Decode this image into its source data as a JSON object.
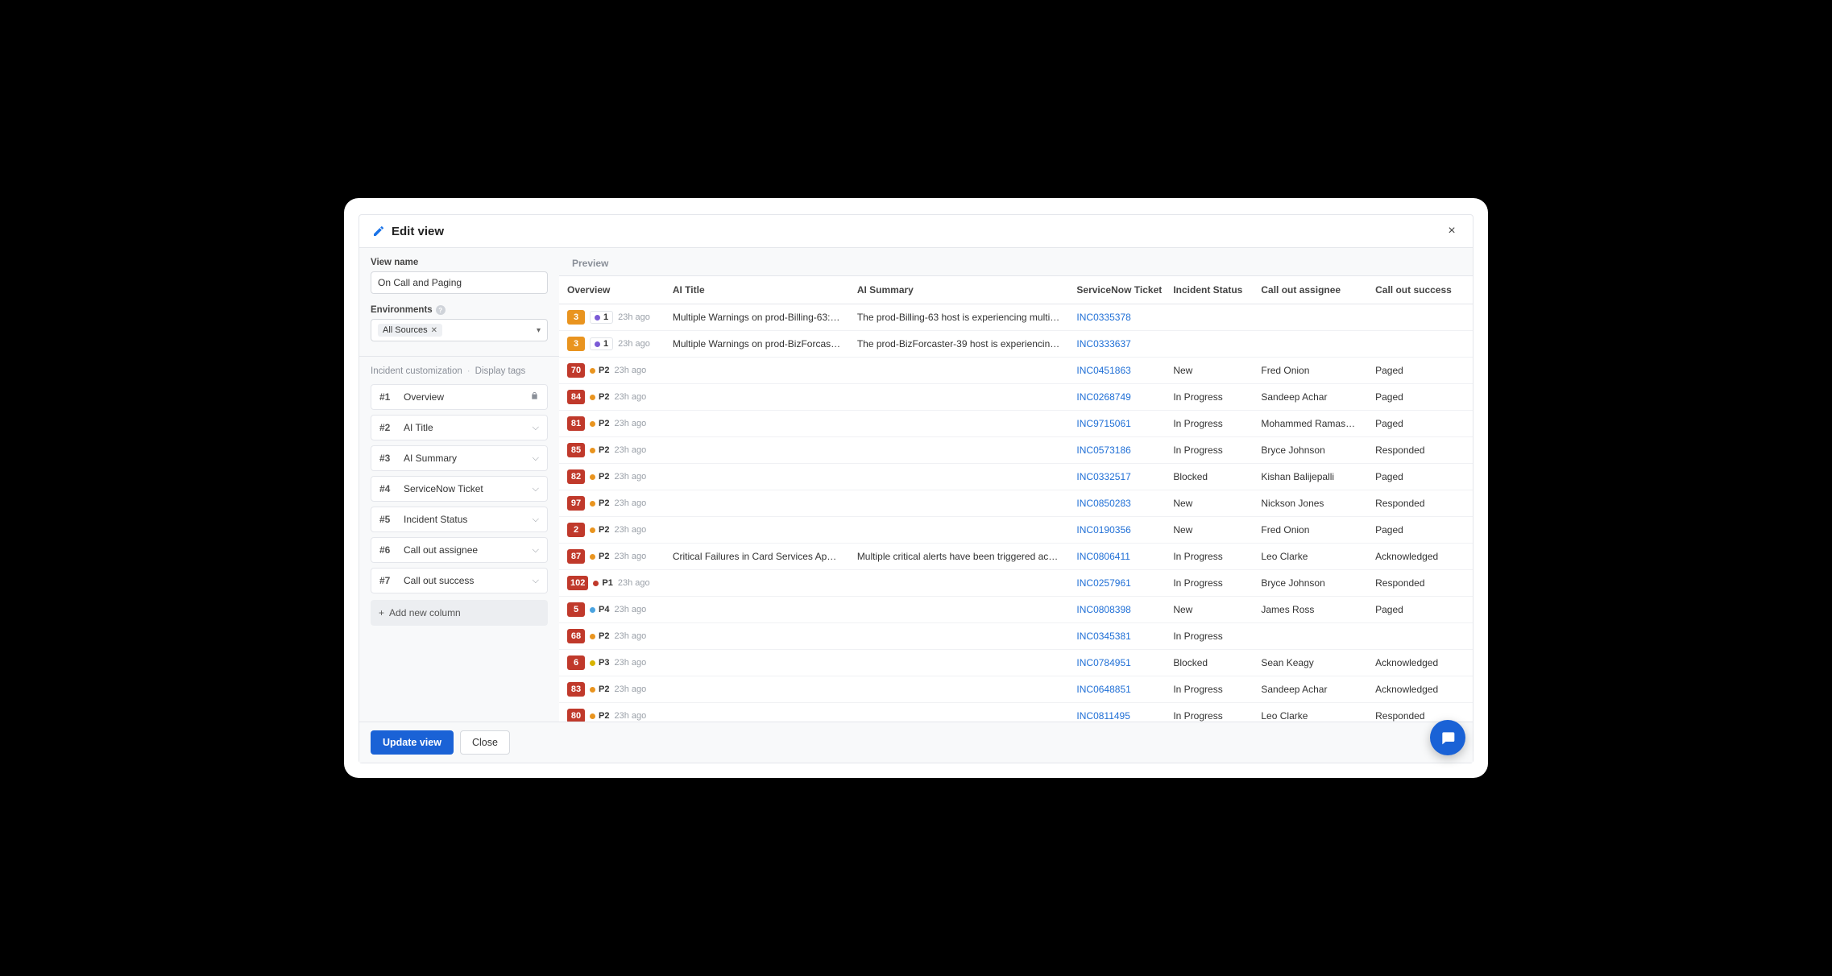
{
  "modal": {
    "title": "Edit view",
    "close_label": "×"
  },
  "sidebar": {
    "view_name_label": "View name",
    "view_name_value": "On Call and Paging",
    "env_label": "Environments",
    "env_chip": "All Sources",
    "customization_label": "Incident customization",
    "display_tags_label": "Display tags",
    "columns": [
      {
        "idx": "#1",
        "name": "Overview",
        "locked": true
      },
      {
        "idx": "#2",
        "name": "AI Title",
        "locked": false
      },
      {
        "idx": "#3",
        "name": "AI Summary",
        "locked": false
      },
      {
        "idx": "#4",
        "name": "ServiceNow Ticket",
        "locked": false
      },
      {
        "idx": "#5",
        "name": "Incident Status",
        "locked": false
      },
      {
        "idx": "#6",
        "name": "Call out assignee",
        "locked": false
      },
      {
        "idx": "#7",
        "name": "Call out success",
        "locked": false
      }
    ],
    "add_column_label": "Add new column"
  },
  "preview": {
    "label": "Preview",
    "headers": [
      "Overview",
      "AI Title",
      "AI Summary",
      "ServiceNow Ticket",
      "Incident Status",
      "Call out assignee",
      "Call out success"
    ],
    "rows": [
      {
        "count": "3",
        "count_color": "orange",
        "priority": "1",
        "priority_class": "purple",
        "outlined": true,
        "age": "23h ago",
        "ai_title": "Multiple Warnings on prod-Billing-63: D...",
        "ai_summary": "The prod-Billing-63 host is experiencing multiple ...",
        "ticket": "INC0335378",
        "status": "",
        "assignee": "",
        "success": ""
      },
      {
        "count": "3",
        "count_color": "orange",
        "priority": "1",
        "priority_class": "purple",
        "outlined": true,
        "age": "23h ago",
        "ai_title": "Multiple Warnings on prod-BizForcaste...",
        "ai_summary": "The prod-BizForcaster-39 host is experiencing m...",
        "ticket": "INC0333637",
        "status": "",
        "assignee": "",
        "success": ""
      },
      {
        "count": "70",
        "count_color": "red",
        "priority": "P2",
        "priority_class": "p2",
        "outlined": false,
        "age": "23h ago",
        "ai_title": "",
        "ai_summary": "",
        "ticket": "INC0451863",
        "status": "New",
        "assignee": "Fred Onion",
        "success": "Paged"
      },
      {
        "count": "84",
        "count_color": "red",
        "priority": "P2",
        "priority_class": "p2",
        "outlined": false,
        "age": "23h ago",
        "ai_title": "",
        "ai_summary": "",
        "ticket": "INC0268749",
        "status": "In Progress",
        "assignee": "Sandeep Achar",
        "success": "Paged"
      },
      {
        "count": "81",
        "count_color": "red",
        "priority": "P2",
        "priority_class": "p2",
        "outlined": false,
        "age": "23h ago",
        "ai_title": "",
        "ai_summary": "",
        "ticket": "INC9715061",
        "status": "In Progress",
        "assignee": "Mohammed Ramaswa...",
        "success": "Paged"
      },
      {
        "count": "85",
        "count_color": "red",
        "priority": "P2",
        "priority_class": "p2",
        "outlined": false,
        "age": "23h ago",
        "ai_title": "",
        "ai_summary": "",
        "ticket": "INC0573186",
        "status": "In Progress",
        "assignee": "Bryce Johnson",
        "success": "Responded"
      },
      {
        "count": "82",
        "count_color": "red",
        "priority": "P2",
        "priority_class": "p2",
        "outlined": false,
        "age": "23h ago",
        "ai_title": "",
        "ai_summary": "",
        "ticket": "INC0332517",
        "status": "Blocked",
        "assignee": "Kishan Balijepalli",
        "success": "Paged"
      },
      {
        "count": "97",
        "count_color": "red",
        "priority": "P2",
        "priority_class": "p2",
        "outlined": false,
        "age": "23h ago",
        "ai_title": "",
        "ai_summary": "",
        "ticket": "INC0850283",
        "status": "New",
        "assignee": "Nickson Jones",
        "success": "Responded"
      },
      {
        "count": "2",
        "count_color": "red",
        "priority": "P2",
        "priority_class": "p2",
        "outlined": false,
        "age": "23h ago",
        "ai_title": "",
        "ai_summary": "",
        "ticket": "INC0190356",
        "status": "New",
        "assignee": "Fred Onion",
        "success": "Paged"
      },
      {
        "count": "87",
        "count_color": "red",
        "priority": "P2",
        "priority_class": "p2",
        "outlined": false,
        "age": "23h ago",
        "ai_title": "Critical Failures in Card Services Applic...",
        "ai_summary": "Multiple critical alerts have been triggered across ...",
        "ticket": "INC0806411",
        "status": "In Progress",
        "assignee": "Leo Clarke",
        "success": "Acknowledged"
      },
      {
        "count": "102",
        "count_color": "red",
        "priority": "P1",
        "priority_class": "p1",
        "outlined": false,
        "age": "23h ago",
        "ai_title": "",
        "ai_summary": "",
        "ticket": "INC0257961",
        "status": "In Progress",
        "assignee": "Bryce Johnson",
        "success": "Responded"
      },
      {
        "count": "5",
        "count_color": "red",
        "priority": "P4",
        "priority_class": "p4",
        "outlined": false,
        "age": "23h ago",
        "ai_title": "",
        "ai_summary": "",
        "ticket": "INC0808398",
        "status": "New",
        "assignee": "James Ross",
        "success": "Paged"
      },
      {
        "count": "68",
        "count_color": "red",
        "priority": "P2",
        "priority_class": "p2",
        "outlined": false,
        "age": "23h ago",
        "ai_title": "",
        "ai_summary": "",
        "ticket": "INC0345381",
        "status": "In Progress",
        "assignee": "",
        "success": ""
      },
      {
        "count": "6",
        "count_color": "red",
        "priority": "P3",
        "priority_class": "p3",
        "outlined": false,
        "age": "23h ago",
        "ai_title": "",
        "ai_summary": "",
        "ticket": "INC0784951",
        "status": "Blocked",
        "assignee": "Sean Keagy",
        "success": "Acknowledged"
      },
      {
        "count": "83",
        "count_color": "red",
        "priority": "P2",
        "priority_class": "p2",
        "outlined": false,
        "age": "23h ago",
        "ai_title": "",
        "ai_summary": "",
        "ticket": "INC0648851",
        "status": "In Progress",
        "assignee": "Sandeep Achar",
        "success": "Acknowledged"
      },
      {
        "count": "80",
        "count_color": "red",
        "priority": "P2",
        "priority_class": "p2",
        "outlined": false,
        "age": "23h ago",
        "ai_title": "",
        "ai_summary": "",
        "ticket": "INC0811495",
        "status": "In Progress",
        "assignee": "Leo Clarke",
        "success": "Responded"
      }
    ]
  },
  "footer": {
    "update_label": "Update view",
    "close_label": "Close"
  }
}
